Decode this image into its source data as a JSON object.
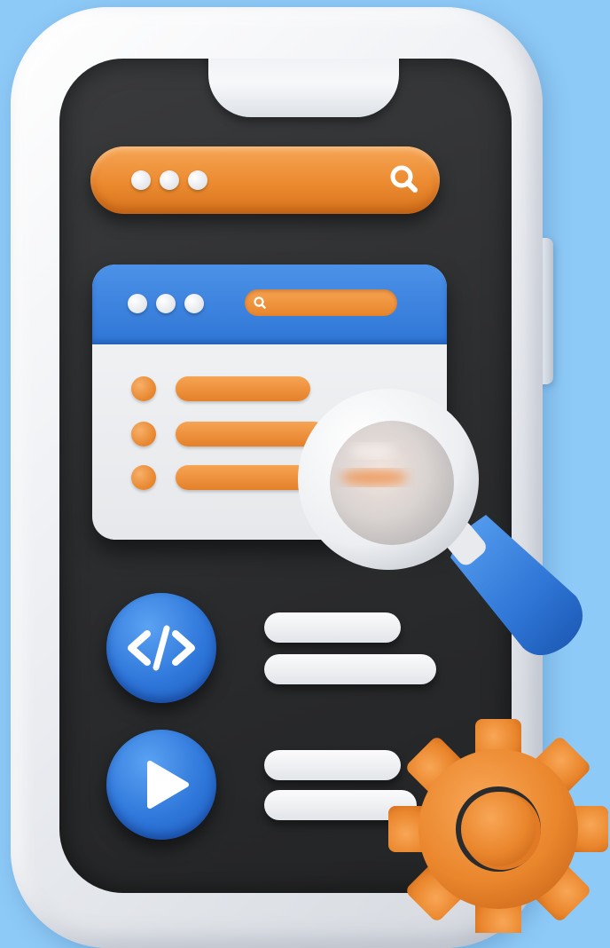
{
  "colors": {
    "background": "#8ecaf7",
    "phone_frame": "#eceef2",
    "screen": "#2e2f31",
    "accent_orange": "#ec8a30",
    "accent_blue": "#2f76d6",
    "light": "#f3f4f6"
  },
  "icons": {
    "top_search": "search-icon",
    "window_search": "search-icon",
    "code": "code-icon",
    "play": "play-icon",
    "magnifier": "magnifying-glass-icon",
    "gear": "gear-icon"
  }
}
